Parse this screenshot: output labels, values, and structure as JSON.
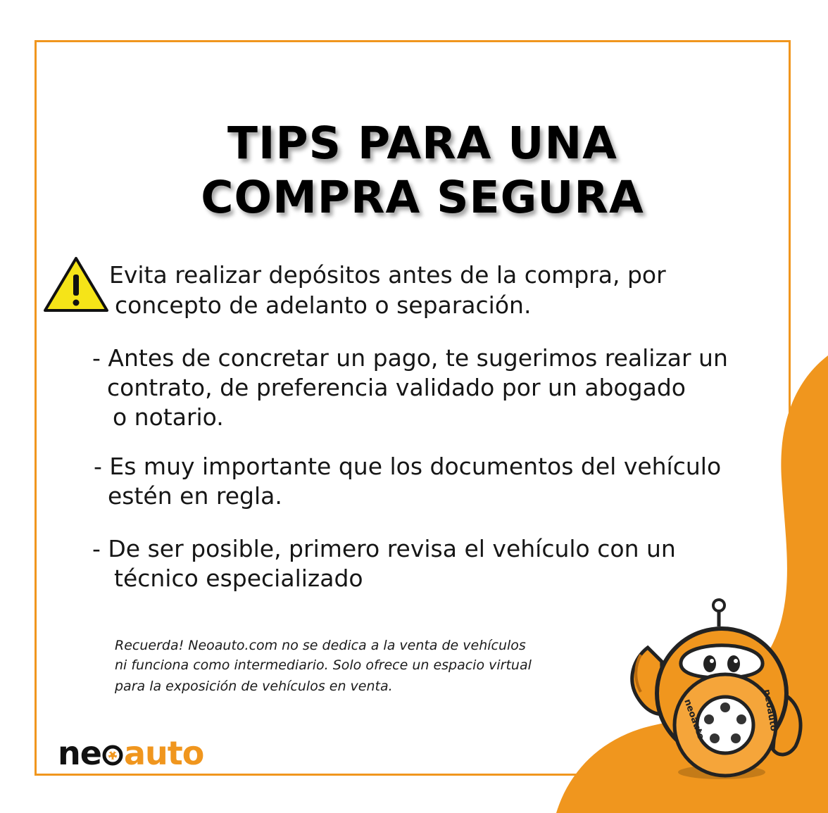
{
  "title": {
    "line1": "TIPS PARA UNA",
    "line2": "COMPRA SEGURA"
  },
  "tips": [
    {
      "line1": "Evita realizar depósitos antes de la compra, por",
      "line2": "concepto de adelanto o separación."
    },
    {
      "line1": "- Antes de concretar un pago, te sugerimos realizar un",
      "line2": "contrato, de preferencia validado por un abogado",
      "line3": "o notario."
    },
    {
      "line1": "- Es muy importante que los documentos del vehículo",
      "line2": "estén en regla."
    },
    {
      "line1": "-  De ser posible, primero revisa el vehículo con un",
      "line2": "técnico especializado"
    }
  ],
  "note": {
    "line1": "Recuerda! Neoauto.com no se dedica a la venta de vehículos",
    "line2": "ni funciona como intermediario. Solo ofrece un espacio virtual",
    "line3": "para la exposición de vehículos en venta."
  },
  "logo": {
    "neo": "ne",
    "o": "o",
    "auto": "auto"
  },
  "mascot_badge": "neoauto",
  "icons": {
    "warning": "warning-triangle-icon",
    "mascot": "robot-mascot"
  },
  "colors": {
    "accent": "#f0961e",
    "warning_yellow": "#f5e418",
    "text": "#161616"
  }
}
